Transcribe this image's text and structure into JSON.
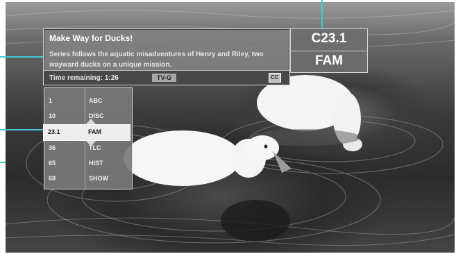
{
  "program": {
    "title": "Make Way for Ducks!",
    "description": "Series follows the aquatic misadventures of Henry and Riley, two wayward ducks on a unique mission.",
    "time_remaining": "Time remaining: 1:26",
    "rating": "TV-G",
    "cc": "CC"
  },
  "current_channel": {
    "number": "C23.1",
    "name": "FAM"
  },
  "channel_list": [
    {
      "number": "1",
      "name": "ABC"
    },
    {
      "number": "10",
      "name": "DISC"
    },
    {
      "number": "23.1",
      "name": "FAM"
    },
    {
      "number": "36",
      "name": "TLC"
    },
    {
      "number": "65",
      "name": "HIST"
    },
    {
      "number": "68",
      "name": "SHOW"
    }
  ],
  "selected_index": 2,
  "colors": {
    "callout": "#3fc9d2",
    "panel_bg": "#828282",
    "selected_row": "#ededed"
  },
  "icons": [
    "up-arrow-icon",
    "down-arrow-icon",
    "cc-icon"
  ]
}
